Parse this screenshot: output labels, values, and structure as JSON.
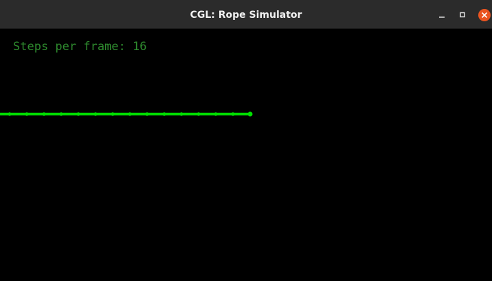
{
  "window": {
    "title": "CGL: Rope Simulator"
  },
  "controls": {
    "minimize_icon": "minimize-icon",
    "maximize_icon": "maximize-icon",
    "close_icon": "close-icon"
  },
  "hud": {
    "steps_label": "Steps per frame: 16"
  },
  "rope": {
    "color": "#00e000",
    "node_count": 15
  },
  "colors": {
    "background": "#000000",
    "titlebar": "#2b2b2b",
    "close_button": "#e95420",
    "hud_text": "#2e8b2e",
    "rope": "#00e000"
  }
}
